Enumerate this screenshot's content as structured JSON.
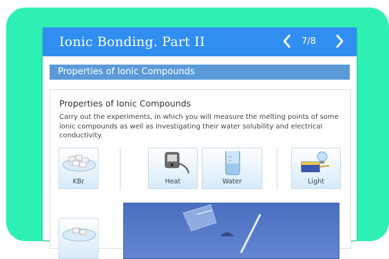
{
  "window": {
    "title": "Ionic Bonding. Part II",
    "page_indicator": "7/8",
    "prev_icon": "chevron-left-icon",
    "next_icon": "chevron-right-icon"
  },
  "section": {
    "header": "Properties of Ionic Compounds"
  },
  "content": {
    "title": "Properties of Ionic Compounds",
    "description": "Carry out the experiments, in which you will measure the melting points of some ionic compounds as well as investigating their water solubility and electrical conductivity."
  },
  "tiles": [
    {
      "label": "KBr",
      "icon": "crystals-icon"
    },
    {
      "label": "Heat",
      "icon": "heater-icon"
    },
    {
      "label": "Water",
      "icon": "beaker-icon"
    },
    {
      "label": "Light",
      "icon": "battery-bulb-icon"
    },
    {
      "label": "",
      "icon": "crystals-icon"
    }
  ],
  "colors": {
    "frame": "#2ef0b4",
    "titlebar": "#2f8ef0",
    "section_bar": "#5b9ad8",
    "stage": "#4a6fbf"
  }
}
